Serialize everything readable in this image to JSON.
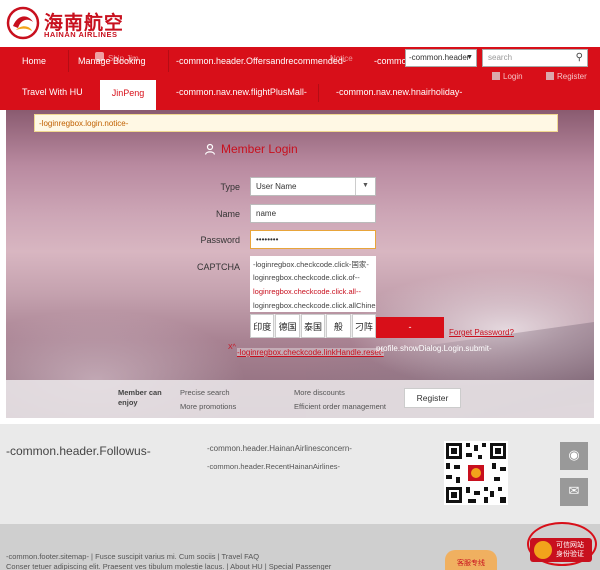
{
  "brand": {
    "name_cn": "海南航空",
    "name_en": "HAINAN AIRLINES"
  },
  "header": {
    "nav": [
      "Home",
      "Manage Booking",
      "-common.header.Offersandrecommended-",
      "-common"
    ],
    "ghost_labels": [
      "Ship Jim",
      "Notice"
    ],
    "language_select": "-common.header",
    "search_placeholder": "search",
    "user_links": {
      "login": "Login",
      "register": "Register"
    }
  },
  "nav2": {
    "items": [
      "Travel With HU",
      "JinPeng",
      "-common.nav.new.flightPlusMall-",
      "-common.nav.new.hnairholiday-"
    ],
    "active": "JinPeng"
  },
  "notice": "-loginregbox.login.notice-",
  "login": {
    "title": "Member Login",
    "type_label": "Type",
    "type_value": "User Name",
    "name_label": "Name",
    "name_value": "name",
    "password_label": "Password",
    "password_value": "••••••••",
    "captcha_label": "CAPTCHA",
    "captcha_suggestions": [
      "-loginregbox.checkcode.click-国家-",
      "loginregbox.checkcode.click.of--",
      "loginregbox.checkcode.click.all--",
      "loginregbox.checkcode.click.allChinese-"
    ],
    "captcha_chars": [
      "印度",
      "德国",
      "泰国",
      "般",
      "刁阵"
    ],
    "login_button": "-",
    "forgot_password": "Forget Password?",
    "red_mark": "X^",
    "link_handle": "-loginregbox.checkcode.linkHandle.reset-",
    "show_dialog": "profile.showDialog.Login.submit-"
  },
  "benefits": {
    "title": "Member can enjoy",
    "items": [
      "Precise search",
      "More promotions",
      "More discounts",
      "Efficient order management"
    ],
    "register_button": "Register"
  },
  "footer": {
    "follow": "-common.header.Followus-",
    "concern": "-common.header.HainanAirlinesconcern-",
    "recent": "-common.header.RecentHainanAirlines-",
    "links_row1": "-common.footer.sitemap-  |  Fusce suscipit varius mi. Cum sociis  |  Travel FAQ",
    "links_row2": "Conser tetuer adipiscing elit. Praesent ves tibulum molestie lacus.  |  About HU  |  Special Passenger",
    "service_badge": "客服专线",
    "trust_badge": "可信网站 身份验证"
  },
  "colors": {
    "brand_red": "#d80f19",
    "link_red": "#c8101e"
  },
  "icons": [
    "user-icon",
    "search-icon",
    "weibo-icon",
    "wechat-icon",
    "login-icon",
    "register-icon",
    "qr-code"
  ]
}
